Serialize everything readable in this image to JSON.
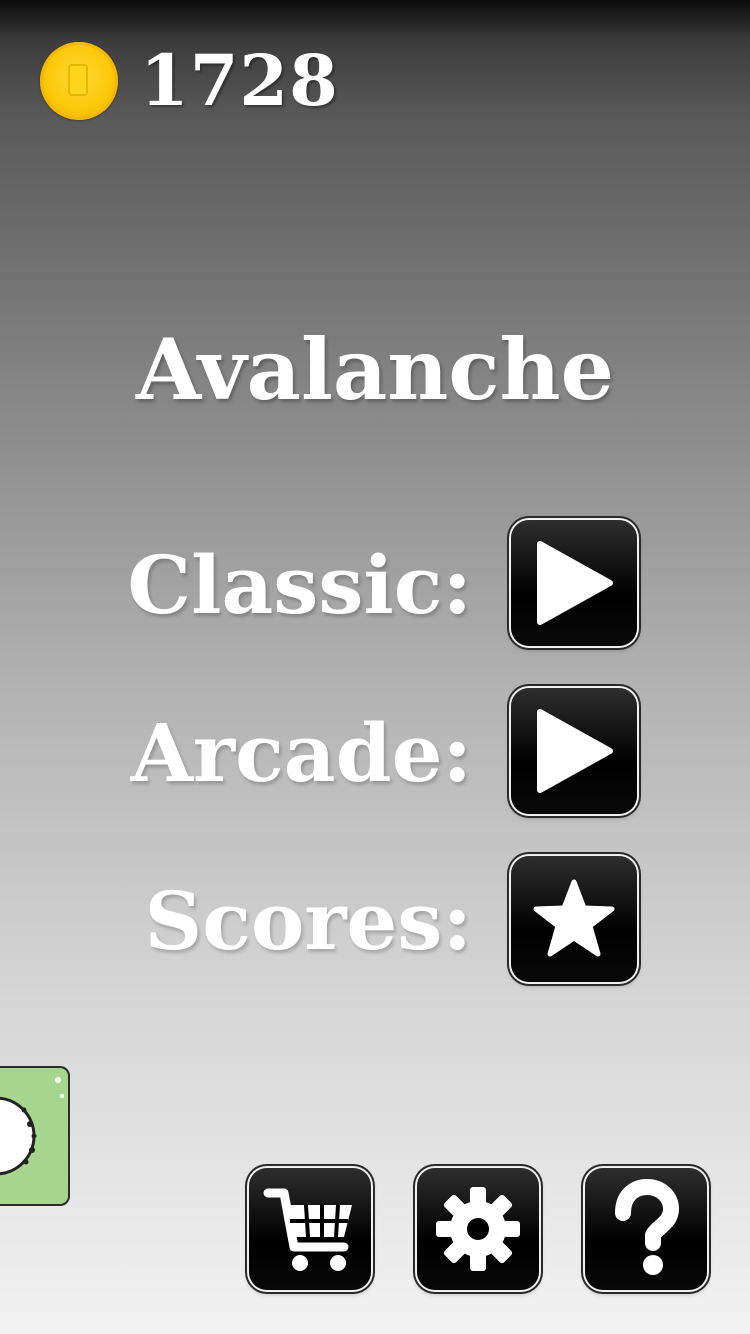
{
  "hud": {
    "coin_icon": "gold-coin-icon",
    "coin_count": "1728"
  },
  "title": "Avalanche",
  "menu": {
    "classic": {
      "label": "Classic:",
      "icon": "play-icon"
    },
    "arcade": {
      "label": "Arcade:",
      "icon": "play-icon"
    },
    "scores": {
      "label": "Scores:",
      "icon": "star-icon"
    }
  },
  "toolbar": {
    "shop_icon": "shopping-cart-icon",
    "settings_icon": "gear-icon",
    "help_icon": "question-mark-icon"
  },
  "promo_badge_icon": "ring-icon",
  "colors": {
    "button_bg": "#000000",
    "coin": "#fcc808",
    "badge": "#a6d68e",
    "text": "#ffffff"
  }
}
